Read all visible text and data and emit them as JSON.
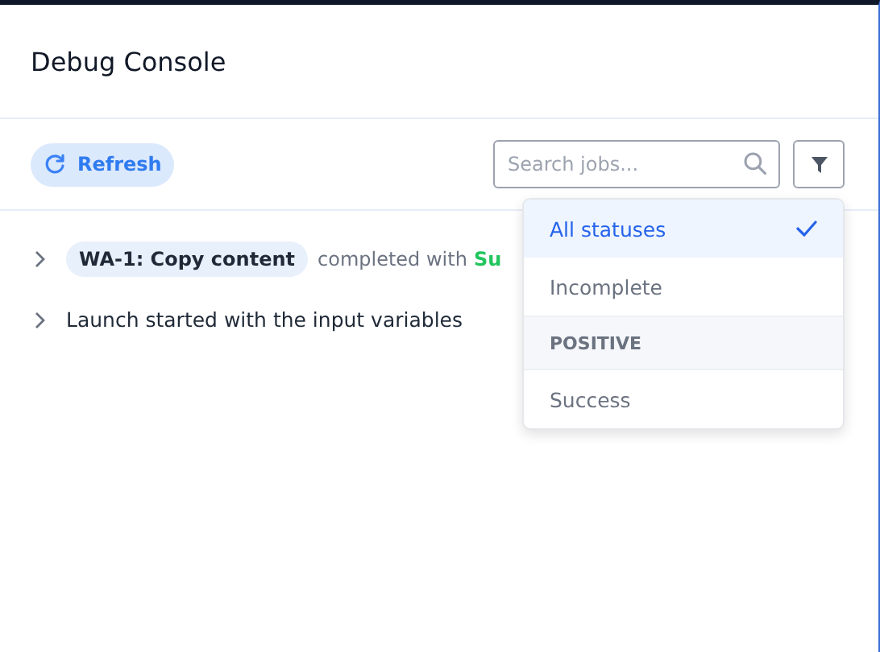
{
  "title": "Debug Console",
  "toolbar": {
    "refresh_label": "Refresh",
    "search": {
      "placeholder": "Search jobs..."
    }
  },
  "log": [
    {
      "kind": "job",
      "tag": "WA-1: Copy content",
      "text": "completed with",
      "status": "Su",
      "color": "#22c55e",
      "expanded": false
    },
    {
      "kind": "plain",
      "text": "Launch started with the input variables",
      "expanded": false
    }
  ],
  "filter_menu": {
    "items": [
      {
        "kind": "option",
        "label": "All statuses",
        "selected": true
      },
      {
        "kind": "option",
        "label": "Incomplete",
        "selected": false
      },
      {
        "kind": "header",
        "label": "POSITIVE"
      },
      {
        "kind": "option",
        "label": "Success",
        "selected": false
      }
    ]
  }
}
